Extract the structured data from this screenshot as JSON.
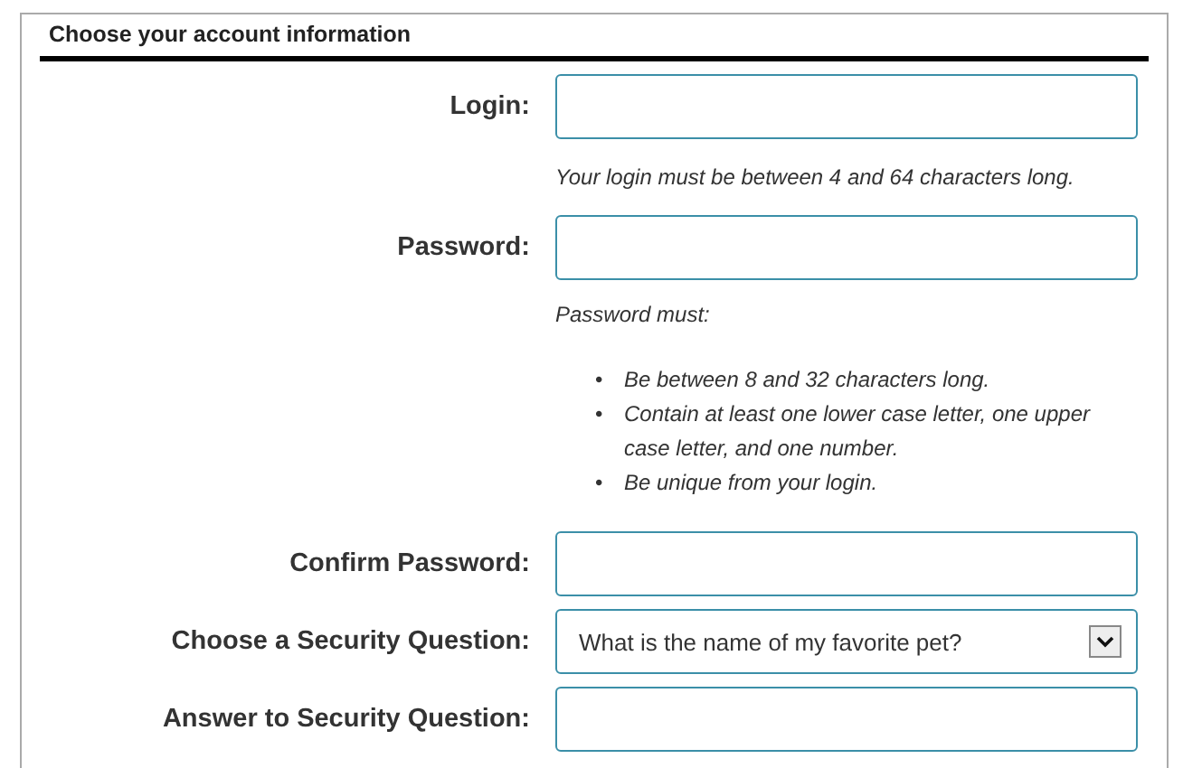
{
  "section": {
    "title": "Choose your account information"
  },
  "rows": [
    {
      "kind": "text",
      "label": "Login:",
      "hint": "Your login must be between 4 and 64 characters long."
    },
    {
      "kind": "text",
      "label": "Password:",
      "hint": "Password must:",
      "rules": [
        {
          "bullet": "•",
          "text": "Be between 8 and 32 characters long."
        },
        {
          "bullet": "•",
          "text": "Contain at least one lower case letter, one upper case letter, and one number."
        },
        {
          "bullet": "•",
          "text": "Be unique from your login."
        }
      ]
    },
    {
      "kind": "text",
      "label": "Confirm Password:"
    },
    {
      "kind": "select",
      "label": "Choose a Security Question:",
      "value": "What is the name of my favorite pet?"
    },
    {
      "kind": "text",
      "label": "Answer to Security Question:"
    }
  ]
}
